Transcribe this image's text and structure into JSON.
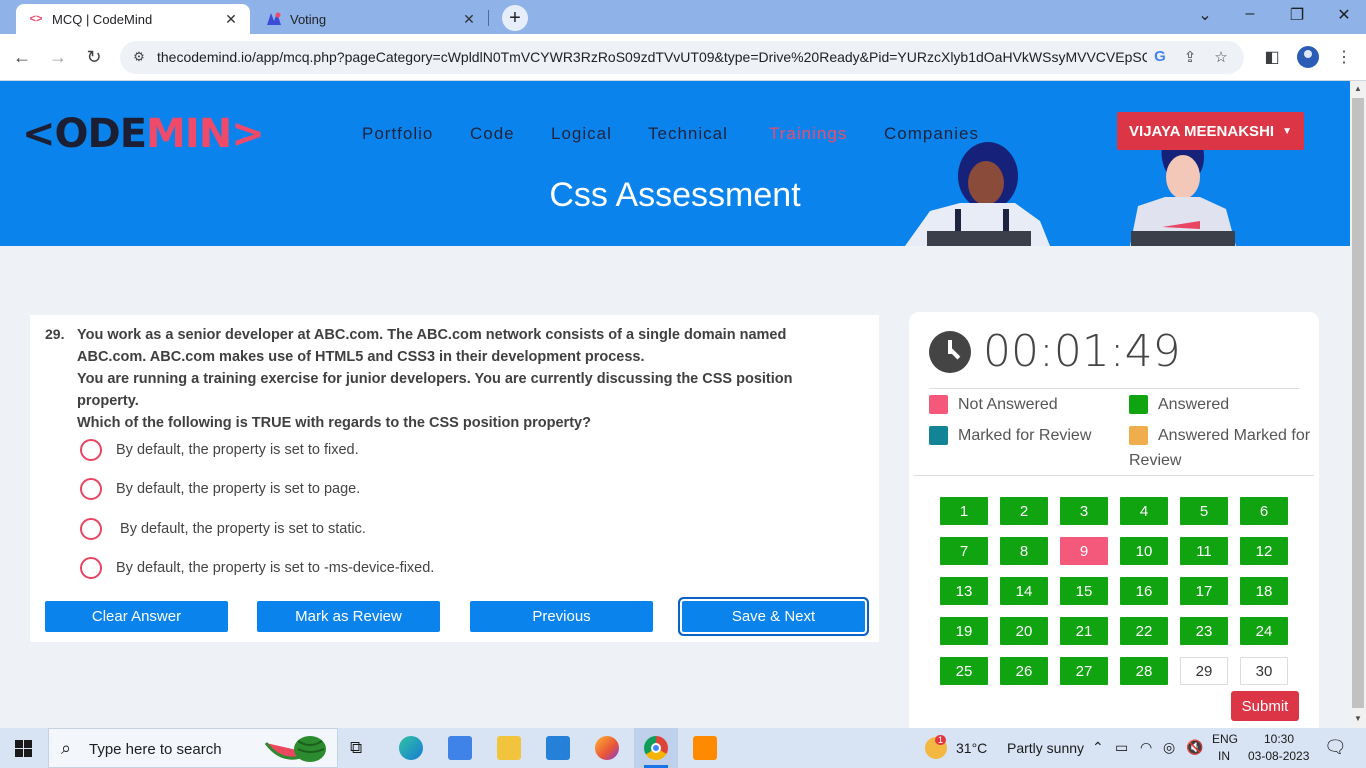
{
  "browser": {
    "tabs": [
      {
        "title": "MCQ | CodeMind",
        "favicon": "<>",
        "active": true
      },
      {
        "title": "Voting",
        "favicon": "voting-logo",
        "active": false
      }
    ],
    "url": "thecodemind.io/app/mcq.php?pageCategory=cWpldlN0TmVCYWR3RzRoS09zdTVvUT09&type=Drive%20Ready&Pid=YURzcXlyb1dOaHVkWSsyMVVCVEpSQT..."
  },
  "header": {
    "logo_dark_1": "<ODE",
    "logo_pink": "MIN",
    "logo_dark_2": ">",
    "nav": [
      "Portfolio",
      "Code",
      "Logical",
      "Technical",
      "Trainings",
      "Companies"
    ],
    "active_nav": "Trainings",
    "user_name": "VIJAYA MEENAKSHI",
    "page_title": "Css Assessment"
  },
  "question": {
    "number": "29.",
    "lines": [
      "You work as a senior developer at ABC.com. The ABC.com network consists of a single domain named ABC.com. ABC.com makes use of HTML5 and CSS3 in their development process.",
      "You are running a training exercise for junior developers. You are currently discussing the CSS position property.",
      "Which of the following is TRUE with regards to the CSS position property?"
    ],
    "options": [
      "By default, the property is set to fixed.",
      "By default, the property is set to page.",
      " By default, the property is set to static.",
      "By default, the property is set to -ms-device-fixed."
    ],
    "buttons": {
      "clear": "Clear Answer",
      "review": "Mark as Review",
      "previous": "Previous",
      "save_next": "Save & Next"
    }
  },
  "panel": {
    "timer": "00:01:49",
    "legend": {
      "not_answered": "Not Answered",
      "answered": "Answered",
      "marked": "Marked for Review",
      "answered_marked": "Answered Marked for Review"
    },
    "colors": {
      "answered": "#10a410",
      "not_answered": "#f4587a",
      "marked": "#138496",
      "answered_marked": "#f0ad4e"
    },
    "questions": [
      {
        "n": "1",
        "status": "answered"
      },
      {
        "n": "2",
        "status": "answered"
      },
      {
        "n": "3",
        "status": "answered"
      },
      {
        "n": "4",
        "status": "answered"
      },
      {
        "n": "5",
        "status": "answered"
      },
      {
        "n": "6",
        "status": "answered"
      },
      {
        "n": "7",
        "status": "answered"
      },
      {
        "n": "8",
        "status": "answered"
      },
      {
        "n": "9",
        "status": "not-answered"
      },
      {
        "n": "10",
        "status": "answered"
      },
      {
        "n": "11",
        "status": "answered"
      },
      {
        "n": "12",
        "status": "answered"
      },
      {
        "n": "13",
        "status": "answered"
      },
      {
        "n": "14",
        "status": "answered"
      },
      {
        "n": "15",
        "status": "answered"
      },
      {
        "n": "16",
        "status": "answered"
      },
      {
        "n": "17",
        "status": "answered"
      },
      {
        "n": "18",
        "status": "answered"
      },
      {
        "n": "19",
        "status": "answered"
      },
      {
        "n": "20",
        "status": "answered"
      },
      {
        "n": "21",
        "status": "answered"
      },
      {
        "n": "22",
        "status": "answered"
      },
      {
        "n": "23",
        "status": "answered"
      },
      {
        "n": "24",
        "status": "answered"
      },
      {
        "n": "25",
        "status": "answered"
      },
      {
        "n": "26",
        "status": "answered"
      },
      {
        "n": "27",
        "status": "answered"
      },
      {
        "n": "28",
        "status": "answered"
      },
      {
        "n": "29",
        "status": "unvisited"
      },
      {
        "n": "30",
        "status": "unvisited"
      }
    ],
    "submit": "Submit"
  },
  "taskbar": {
    "search_placeholder": "Type here to search",
    "weather_temp": "31°C",
    "weather_text": "Partly sunny",
    "weather_badge": "1",
    "lang_1": "ENG",
    "lang_2": "IN",
    "time": "10:30",
    "date": "03-08-2023"
  }
}
